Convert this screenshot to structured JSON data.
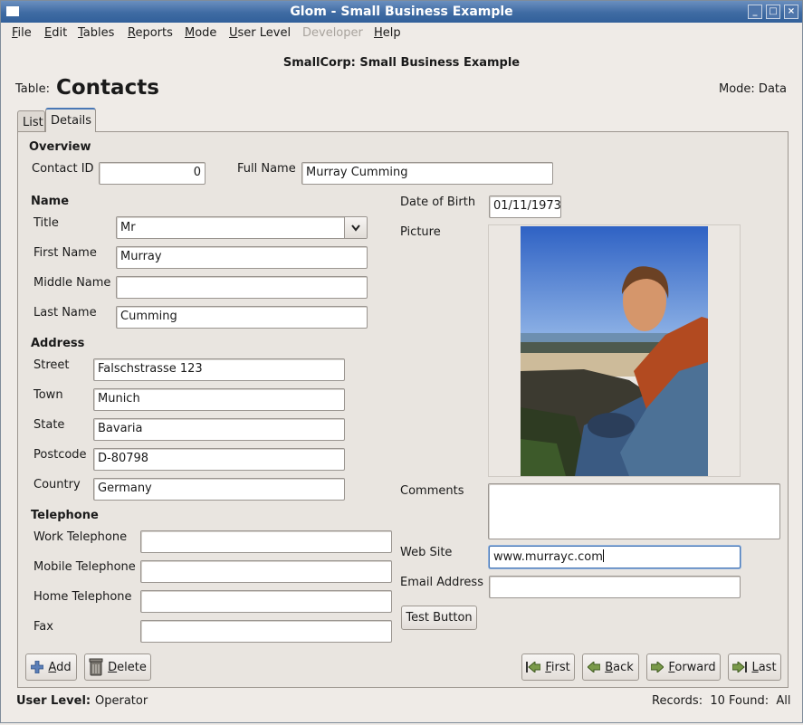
{
  "window": {
    "title": "Glom - Small Business Example",
    "min": "_",
    "max": "□",
    "close": "×"
  },
  "menubar": {
    "file": {
      "u": "F",
      "rest": "ile"
    },
    "edit": {
      "u": "E",
      "rest": "dit"
    },
    "tables": {
      "u": "T",
      "rest": "ables"
    },
    "reports": {
      "u": "R",
      "rest": "eports"
    },
    "mode": {
      "u": "M",
      "rest": "ode"
    },
    "user_level": {
      "u": "U",
      "rest": "ser Level"
    },
    "developer": "Developer",
    "help": {
      "u": "H",
      "rest": "elp"
    }
  },
  "database_title": "SmallCorp: Small Business Example",
  "table": {
    "label": "Table:",
    "name": "Contacts"
  },
  "mode": "Mode: Data",
  "tabs": {
    "list": "List",
    "details": "Details"
  },
  "overview": {
    "heading": "Overview",
    "contact_id_label": "Contact ID",
    "contact_id": "0",
    "full_name_label": "Full Name",
    "full_name": "Murray Cumming"
  },
  "name": {
    "heading": "Name",
    "title_label": "Title",
    "title": "Mr",
    "first_name_label": "First Name",
    "first_name": "Murray",
    "middle_name_label": "Middle Name",
    "middle_name": "",
    "last_name_label": "Last Name",
    "last_name": "Cumming"
  },
  "address": {
    "heading": "Address",
    "street_label": "Street",
    "street": "Falschstrasse 123",
    "town_label": "Town",
    "town": "Munich",
    "state_label": "State",
    "state": "Bavaria",
    "postcode_label": "Postcode",
    "postcode": "D-80798",
    "country_label": "Country",
    "country": "Germany"
  },
  "telephone": {
    "heading": "Telephone",
    "work_label": "Work Telephone",
    "work": "",
    "mobile_label": "Mobile Telephone",
    "mobile": "",
    "home_label": "Home Telephone",
    "home": "",
    "fax_label": "Fax",
    "fax": ""
  },
  "right": {
    "dob_label": "Date of Birth",
    "dob": "01/11/1973",
    "picture_label": "Picture",
    "comments_label": "Comments",
    "comments": "",
    "website_label": "Web Site",
    "website": "www.murrayc.com",
    "email_label": "Email Address",
    "email": "",
    "test_button": "Test Button"
  },
  "actions": {
    "add": {
      "u": "A",
      "rest": "dd"
    },
    "delete": {
      "u": "D",
      "rest": "elete"
    },
    "first": {
      "u": "F",
      "rest": "irst"
    },
    "back": {
      "u": "B",
      "rest": "ack"
    },
    "forward": {
      "u": "F",
      "rest": "orward"
    },
    "last": {
      "u": "L",
      "rest": "ast"
    }
  },
  "status": {
    "user_level_label": "User Level:",
    "user_level": "Operator",
    "records": "Records:  10 Found:  All"
  },
  "colors": {
    "titlebar": "#3f6ba3",
    "focus": "#4a78b5",
    "sky": "#3e6fc9"
  }
}
